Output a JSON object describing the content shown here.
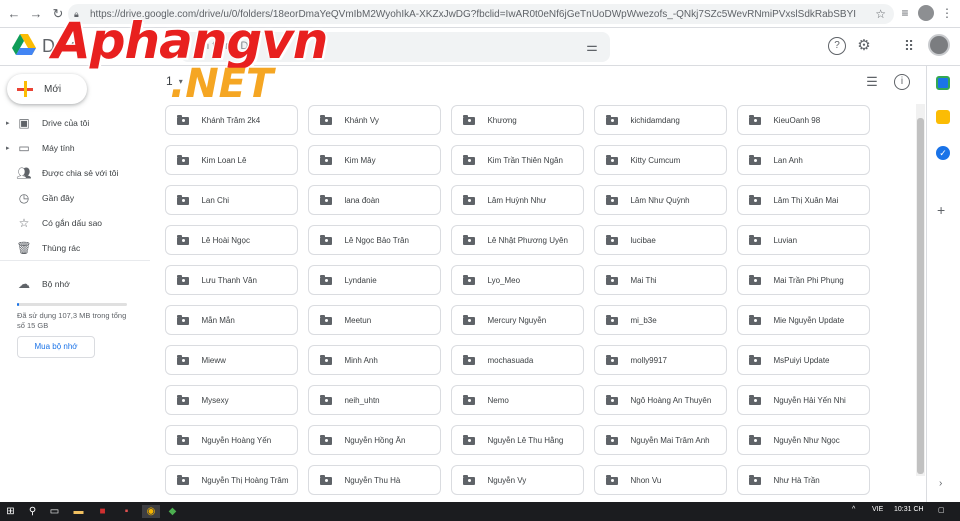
{
  "browser": {
    "url": "https://drive.google.com/drive/u/0/folders/18eorDmaYeQVmIbM2WyohIkA-XKZxJwDG?fbclid=IwAR0t0eNf6jGeTnUoDWpWwezofs_-QNkj7SZc5WevRNmiPVxslSdkRabSBYI"
  },
  "header": {
    "app_title": "Drive",
    "search_placeholder": "m trong Dr"
  },
  "watermark": {
    "line1": "Aphangvn",
    "line2": ".NET"
  },
  "sidebar": {
    "new_label": "Mới",
    "items": [
      {
        "label": "Drive của tôi",
        "icon": "drive-icon",
        "arrow": "▸"
      },
      {
        "label": "Máy tính",
        "icon": "computer-icon",
        "arrow": "▸"
      },
      {
        "label": "Được chia sẻ với tôi",
        "icon": "shared-icon",
        "arrow": ""
      },
      {
        "label": "Gần đây",
        "icon": "clock-icon",
        "arrow": ""
      },
      {
        "label": "Có gắn dấu sao",
        "icon": "star-icon",
        "arrow": ""
      },
      {
        "label": "Thùng rác",
        "icon": "trash-icon",
        "arrow": ""
      }
    ],
    "storage_label": "Bộ nhớ",
    "storage_text": "Đã sử dụng 107,3 MB trong tổng số 15 GB",
    "storage_fraction": 0.007,
    "buy_storage_label": "Mua bộ nhớ"
  },
  "main": {
    "breadcrumb": "1"
  },
  "folders": [
    "Khánh Trâm 2k4",
    "Khánh Vy",
    "Khương",
    "kichidamdang",
    "KieuOanh 98",
    "Kim Loan Lê",
    "Kim Mây",
    "Kim Trần Thiên Ngân",
    "Kitty Cumcum",
    "Lan Anh",
    "Lan Chi",
    "lana đoàn",
    "Lâm Huỳnh Như",
    "Lâm Như Quỳnh",
    "Lâm Thị Xuân Mai",
    "Lê Hoài Ngọc",
    "Lê Ngọc Bảo Trân",
    "Lê Nhật Phương Uyên",
    "lucibae",
    "Luvian",
    "Lưu Thanh Vân",
    "Lyndanie",
    "Lyo_Meo",
    "Mai Thi",
    "Mai Trần Phi Phụng",
    "Mẫn Mẫn",
    "Meetun",
    "Mercury Nguyễn",
    "mi_b3e",
    "Mie Nguyễn Update",
    "Mieww",
    "Minh Anh",
    "mochasuada",
    "molly9917",
    "MsPuiyi Update",
    "Mysexy",
    "neih_uhtn",
    "Nemo",
    "Ngô Hoàng An Thuyên",
    "Nguyễn Hải Yến Nhi",
    "Nguyễn Hoàng Yến",
    "Nguyễn Hồng Ân",
    "Nguyễn Lê Thu Hằng",
    "Nguyễn Mai Trâm Anh",
    "Nguyễn Như Ngọc",
    "Nguyễn Thị Hoàng Trâm",
    "Nguyễn Thu Hà",
    "Nguyễn Vy",
    "Nhon Vu",
    "Như Hà Trần"
  ],
  "taskbar": {
    "lang": "VIE",
    "time": "10:31 CH"
  },
  "colors": {
    "accent": "#1a73e8",
    "watermark_red": "#e8201f",
    "watermark_orange": "#f5a623"
  }
}
